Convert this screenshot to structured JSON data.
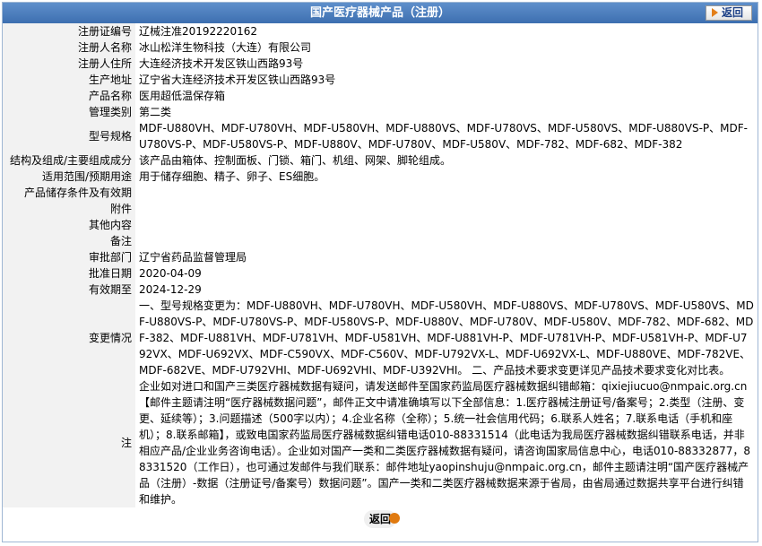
{
  "title": "国产医疗器械产品（注册）",
  "back_label": "返回",
  "rows": [
    {
      "label": "注册证编号",
      "value": "辽械注准20192220162"
    },
    {
      "label": "注册人名称",
      "value": "冰山松洋生物科技（大连）有限公司"
    },
    {
      "label": "注册人住所",
      "value": "大连经济技术开发区铁山西路93号"
    },
    {
      "label": "生产地址",
      "value": "辽宁省大连经济技术开发区铁山西路93号"
    },
    {
      "label": "产品名称",
      "value": "医用超低温保存箱"
    },
    {
      "label": "管理类别",
      "value": "第二类"
    },
    {
      "label": "型号规格",
      "value": "MDF-U880VH、MDF-U780VH、MDF-U580VH、MDF-U880VS、MDF-U780VS、MDF-U580VS、MDF-U880VS-P、MDF-U780VS-P、MDF-U580VS-P、MDF-U880V、MDF-U780V、MDF-U580V、MDF-782、MDF-682、MDF-382"
    },
    {
      "label": "结构及组成/主要组成成分",
      "value": "该产品由箱体、控制面板、门锁、箱门、机组、网架、脚轮组成。"
    },
    {
      "label": "适用范围/预期用途",
      "value": "用于储存细胞、精子、卵子、ES细胞。"
    },
    {
      "label": "产品储存条件及有效期",
      "value": ""
    },
    {
      "label": "附件",
      "value": ""
    },
    {
      "label": "其他内容",
      "value": ""
    },
    {
      "label": "备注",
      "value": ""
    },
    {
      "label": "审批部门",
      "value": "辽宁省药品监督管理局"
    },
    {
      "label": "批准日期",
      "value": "2020-04-09"
    },
    {
      "label": "有效期至",
      "value": "2024-12-29"
    },
    {
      "label": "变更情况",
      "value": "一、型号规格变更为：MDF-U880VH、MDF-U780VH、MDF-U580VH、MDF-U880VS、MDF-U780VS、MDF-U580VS、MDF-U880VS-P、MDF-U780VS-P、MDF-U580VS-P、MDF-U880V、MDF-U780V、MDF-U580V、MDF-782、MDF-682、MDF-382、MDF-U881VH、MDF-U781VH、MDF-U581VH、MDF-U881VH-P、MDF-U781VH-P、MDF-U581VH-P、MDF-U792VX、MDF-U692VX、MDF-C590VX、MDF-C560V、MDF-U792VX-L、MDF-U692VX-L、MDF-U880VE、MDF-782VE、MDF-682VE、MDF-U792VHI、MDF-U692VHI、MDF-U392VHI。 二、产品技术要求变更详见产品技术要求变化对比表。"
    },
    {
      "label": "注",
      "value": "企业如对进口和国产三类医疗器械数据有疑问，请发送邮件至国家药监局医疗器械数据纠错邮箱：qixiejiucuo@nmpaic.org.cn【邮件主题请注明“医疗器械数据问题”，邮件正文中请准确填写以下全部信息：1.医疗器械注册证号/备案号；2.类型（注册、变更、延续等）；3.问题描述（500字以内）；4.企业名称（全称）；5.统一社会信用代码；6.联系人姓名；7.联系电话（手机和座机）；8.联系邮箱】，或致电国家药监局医疗器械数据纠错电话010-88331514（此电话为我局医疗器械数据纠错联系电话，并非相应产品/企业业务咨询电话）。企业如对国产一类和二类医疗器械数据有疑问，请咨询国家局信息中心，电话010-88332877，88331520（工作日），也可通过发邮件与我们联系：邮件地址yaopinshuju@nmpaic.org.cn，邮件主题请注明“国产医疗器械产品（注册）-数据（注册证号/备案号）数据问题”。国产一类和二类医疗器械数据来源于省局，由省局通过数据共享平台进行纠错和维护。"
    }
  ]
}
